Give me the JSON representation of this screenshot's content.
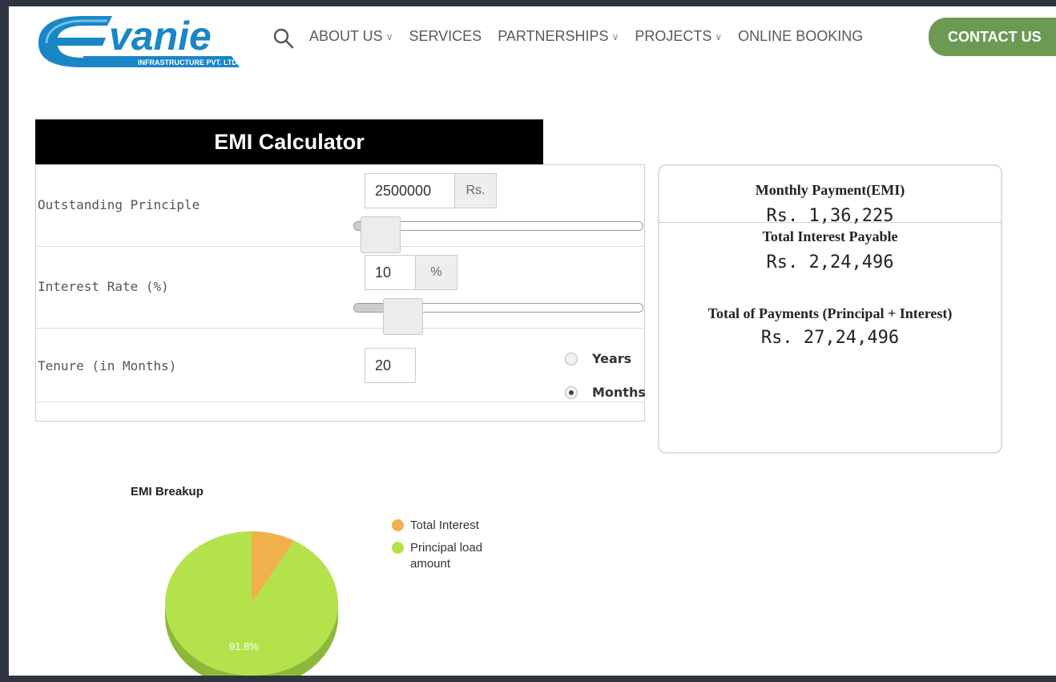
{
  "header": {
    "logo_text": "vanie",
    "logo_sub": "INFRASTRUCTURE PVT. LTD.",
    "nav": [
      {
        "label": "ABOUT US",
        "dropdown": true
      },
      {
        "label": "SERVICES",
        "dropdown": false
      },
      {
        "label": "PARTNERSHIPS",
        "dropdown": true
      },
      {
        "label": "PROJECTS",
        "dropdown": true
      },
      {
        "label": "ONLINE BOOKING",
        "dropdown": false
      }
    ],
    "contact_label": "CONTACT US"
  },
  "calculator": {
    "title": "EMI Calculator",
    "principal": {
      "label": "Outstanding Principle",
      "value": "2500000",
      "unit": "Rs.",
      "slider_fraction": 0.03
    },
    "rate": {
      "label": "Interest Rate (%)",
      "value": "10",
      "unit": "%",
      "slider_fraction": 0.12
    },
    "tenure": {
      "label": "Tenure (in Months)",
      "value": "20",
      "options": [
        "Years",
        "Months"
      ],
      "selected": "Months"
    }
  },
  "results": {
    "emi_label": "Monthly Payment(EMI)",
    "emi_value": "Rs. 1,36,225",
    "interest_label": "Total Interest Payable",
    "interest_value": "Rs. 2,24,496",
    "total_label": "Total of Payments (Principal + Interest)",
    "total_value": "Rs. 27,24,496"
  },
  "chart_data": {
    "type": "pie",
    "title": "EMI Breakup",
    "slices": [
      {
        "label": "Total Interest",
        "value": 8.2,
        "color": "#f0b04c"
      },
      {
        "label": "Principal load amount",
        "value": 91.8,
        "color": "#b4e24a"
      }
    ],
    "data_labels": [
      "91.8%"
    ],
    "legend_position": "right"
  }
}
